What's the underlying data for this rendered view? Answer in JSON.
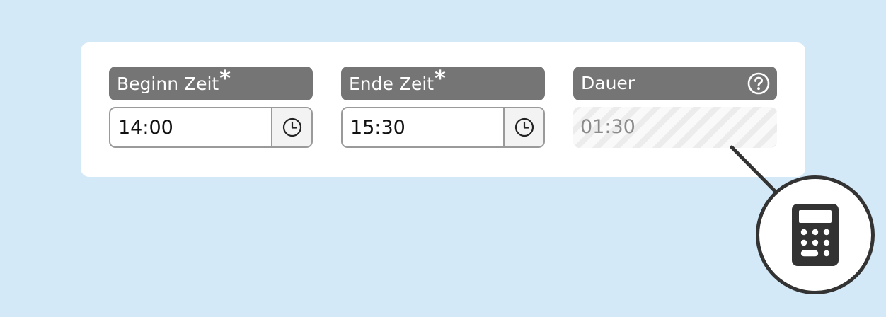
{
  "fields": {
    "start": {
      "label": "Beginn Zeit",
      "required_mark": "*",
      "value": "14:00",
      "icon": "clock-icon"
    },
    "end": {
      "label": "Ende Zeit",
      "required_mark": "*",
      "value": "15:30",
      "icon": "clock-icon"
    },
    "duration": {
      "label": "Dauer",
      "value": "01:30",
      "help_icon": "help-icon"
    }
  },
  "callout": {
    "icon": "calculator-icon"
  },
  "colors": {
    "background": "#d4e9f8",
    "card": "#ffffff",
    "label_bar": "#757575",
    "border": "#9a9a9a",
    "readonly_text": "#8a8a8a",
    "callout_border": "#333333"
  }
}
